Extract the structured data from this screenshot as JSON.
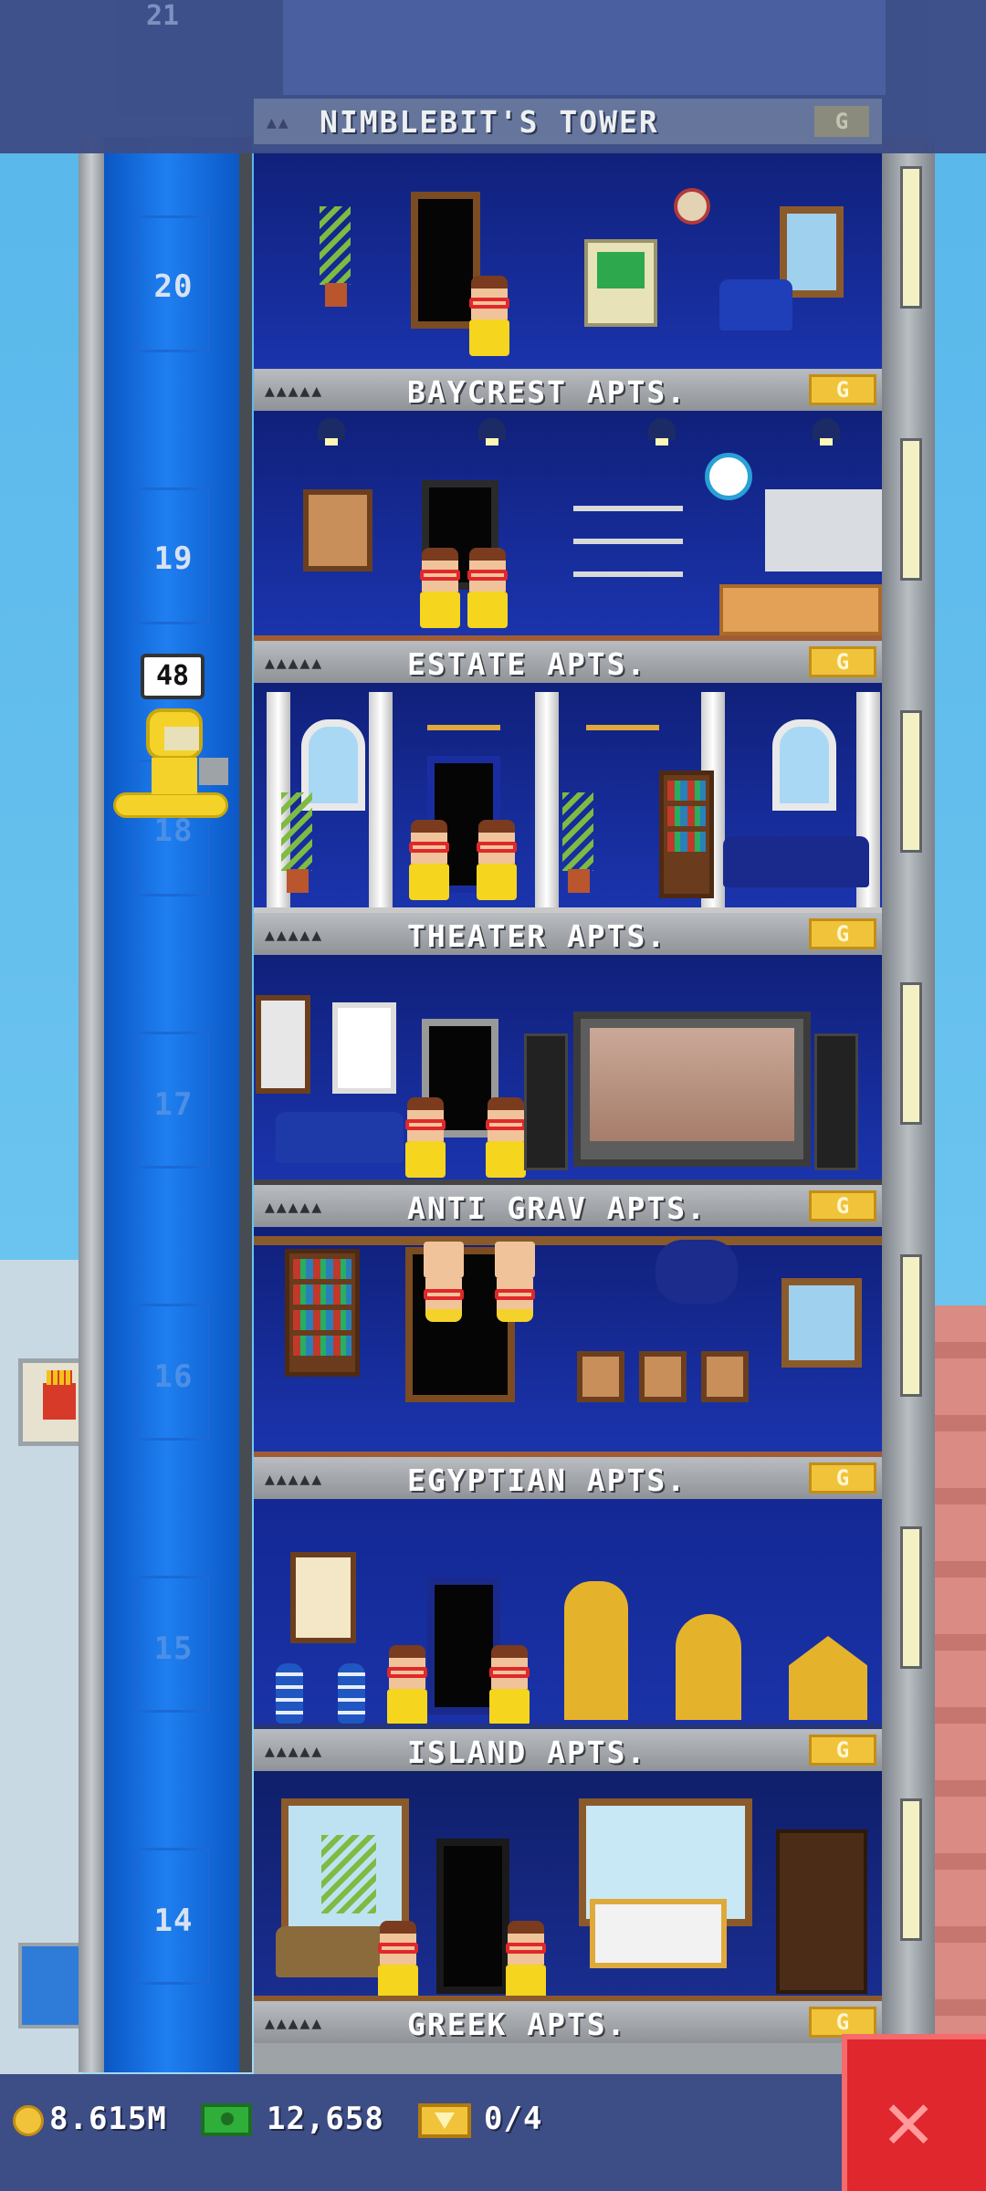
{
  "top": {
    "ghost_floor_number": "21",
    "tower_name": "NIMBLEBIT'S TOWER",
    "tower_dots": "▲▲",
    "tower_badge": "G"
  },
  "elevator": {
    "bubble_count": "48",
    "floor_numbers": [
      "20",
      "19",
      "18",
      "17",
      "16",
      "15",
      "14"
    ]
  },
  "floors": [
    {
      "number": "20",
      "label": "BAYCREST APTS.",
      "badge": "G",
      "dots": "▲▲▲▲▲"
    },
    {
      "number": "19",
      "label": "ESTATE APTS.",
      "badge": "G",
      "dots": "▲▲▲▲▲"
    },
    {
      "number": "18",
      "label": "THEATER APTS.",
      "badge": "G",
      "dots": "▲▲▲▲▲"
    },
    {
      "number": "17",
      "label": "ANTI GRAV APTS.",
      "badge": "G",
      "dots": "▲▲▲▲▲"
    },
    {
      "number": "16",
      "label": "EGYPTIAN APTS.",
      "badge": "G",
      "dots": "▲▲▲▲▲"
    },
    {
      "number": "15",
      "label": "ISLAND APTS.",
      "badge": "G",
      "dots": "▲▲▲▲▲"
    },
    {
      "number": "14",
      "label": "GREEK APTS.",
      "badge": "G",
      "dots": "▲▲▲▲▲"
    }
  ],
  "hud": {
    "coins": "8.615M",
    "bux": "12,658",
    "tickets": "0/4",
    "close_icon": "close-icon"
  },
  "colors": {
    "sky": "#5bb8ea",
    "elevator": "#1f7ff0",
    "floor_wall": "#1b35b0",
    "label_gray": "#a4a8ad",
    "gold": "#f1c33a",
    "close_red": "#e0272d"
  }
}
